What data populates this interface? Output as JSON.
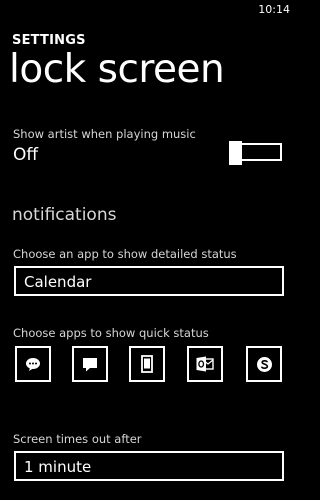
{
  "status_bar": {
    "time": "10:14"
  },
  "header": {
    "app_title": "SETTINGS",
    "page_title": "lock screen"
  },
  "music_artist": {
    "label": "Show artist when playing music",
    "value": "Off",
    "enabled": false
  },
  "notifications": {
    "header": "notifications",
    "detailed_status_label": "Choose an app to show detailed status",
    "detailed_status_value": "Calendar",
    "quick_status_label": "Choose apps to show quick status",
    "quick_status_icons": [
      "messaging-icon",
      "chat-icon",
      "phone-icon",
      "outlook-icon",
      "skype-icon"
    ]
  },
  "screen_timeout": {
    "label": "Screen times out after",
    "value": "1 minute"
  }
}
